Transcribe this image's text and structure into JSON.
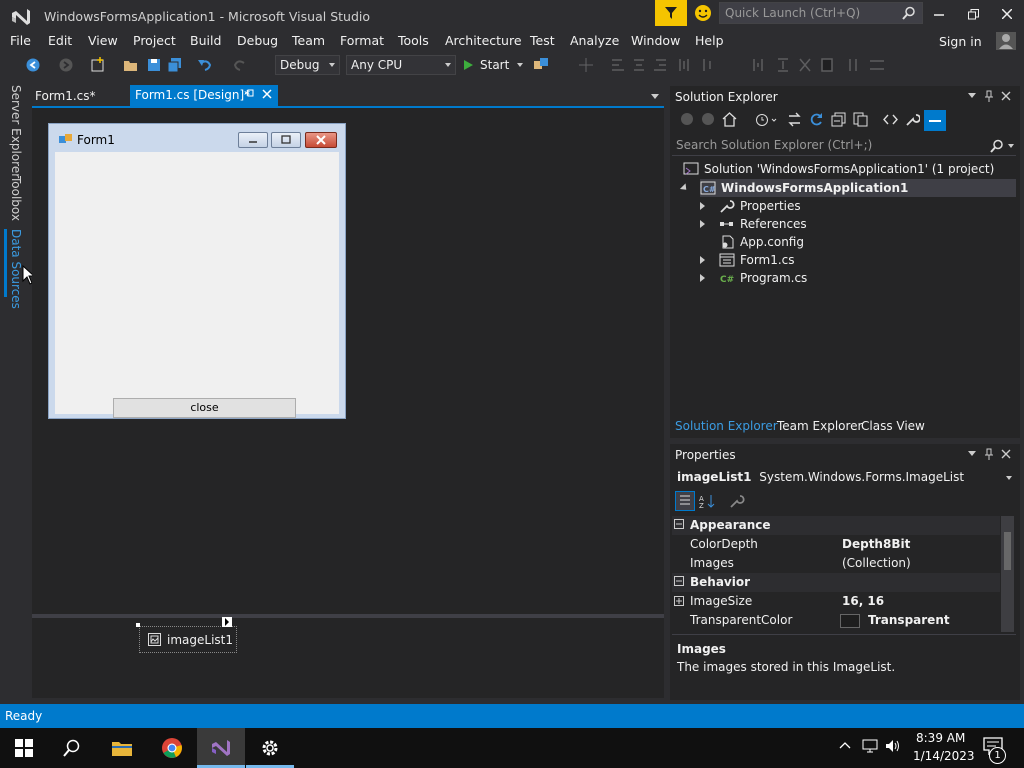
{
  "window": {
    "title": "WindowsFormsApplication1 - Microsoft Visual Studio",
    "quick_launch_placeholder": "Quick Launch (Ctrl+Q)"
  },
  "menu": {
    "items": [
      "File",
      "Edit",
      "View",
      "Project",
      "Build",
      "Debug",
      "Team",
      "Format",
      "Tools",
      "Architecture",
      "Test",
      "Analyze",
      "Window",
      "Help"
    ],
    "sign_in": "Sign in"
  },
  "toolbar": {
    "configuration": "Debug",
    "platform": "Any CPU",
    "start_label": "Start"
  },
  "side_tabs": [
    "Server Explorer",
    "Toolbox",
    "Data Sources"
  ],
  "doc_tabs": [
    {
      "label": "Form1.cs*",
      "active": false
    },
    {
      "label": "Form1.cs [Design]*",
      "active": true
    }
  ],
  "designer": {
    "form_title": "Form1",
    "button_label": "close",
    "component_tray_item": "imageList1"
  },
  "solution_explorer": {
    "title": "Solution Explorer",
    "search_placeholder": "Search Solution Explorer (Ctrl+;)",
    "tree": [
      {
        "label": "Solution 'WindowsFormsApplication1' (1 project)",
        "icon": "solution-icon"
      },
      {
        "label": "WindowsFormsApplication1",
        "icon": "csharp-project-icon"
      },
      {
        "label": "Properties",
        "icon": "wrench-icon"
      },
      {
        "label": "References",
        "icon": "references-icon"
      },
      {
        "label": "App.config",
        "icon": "config-file-icon"
      },
      {
        "label": "Form1.cs",
        "icon": "form-icon"
      },
      {
        "label": "Program.cs",
        "icon": "csharp-file-icon"
      }
    ],
    "bottom_tabs": [
      "Solution Explorer",
      "Team Explorer",
      "Class View"
    ]
  },
  "properties": {
    "title": "Properties",
    "object_name": "imageList1",
    "object_type": "System.Windows.Forms.ImageList",
    "rows": [
      {
        "name": "Appearance",
        "category": true
      },
      {
        "name": "ColorDepth",
        "value": "Depth8Bit",
        "bold": true
      },
      {
        "name": "Images",
        "value": "(Collection)",
        "bold": false
      },
      {
        "name": "Behavior",
        "category": true
      },
      {
        "name": "ImageSize",
        "value": "16, 16",
        "bold": true
      },
      {
        "name": "TransparentColor",
        "value": "Transparent",
        "bold": true
      }
    ],
    "description_title": "Images",
    "description_text": "The images stored in this ImageList."
  },
  "status": {
    "text": "Ready"
  },
  "taskbar": {
    "time": "8:39 AM",
    "date": "1/14/2023",
    "notification_count": "1"
  },
  "colors": {
    "accent": "#007acc",
    "background": "#2d2d30",
    "panel": "#252526",
    "highlight_filter": "#f5c400"
  }
}
